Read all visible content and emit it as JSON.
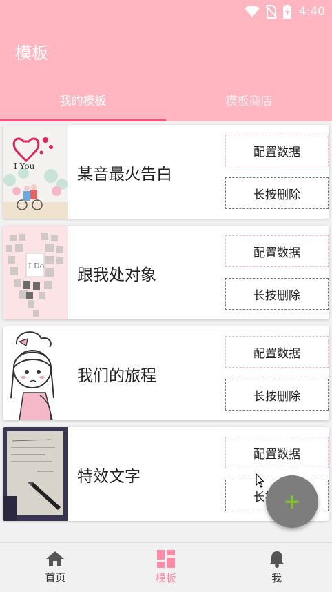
{
  "status": {
    "time": "4:40"
  },
  "app": {
    "title": "模板"
  },
  "tabs": [
    {
      "label": "我的模板",
      "active": true
    },
    {
      "label": "模板商店",
      "active": false
    }
  ],
  "templates": [
    {
      "title": "某音最火告白",
      "config_label": "配置数据",
      "delete_label": "长按删除",
      "thumb_text": "I  You"
    },
    {
      "title": "跟我处对象",
      "config_label": "配置数据",
      "delete_label": "长按删除",
      "thumb_text": "I Do"
    },
    {
      "title": "我们的旅程",
      "config_label": "配置数据",
      "delete_label": "长按删除"
    },
    {
      "title": "特效文字",
      "config_label": "配置数据",
      "delete_label": "长按删除"
    }
  ],
  "fab": {
    "label": "+"
  },
  "bottom_nav": [
    {
      "label": "首页",
      "icon": "home-icon",
      "active": false
    },
    {
      "label": "模板",
      "icon": "template-grid-icon",
      "active": true
    },
    {
      "label": "我",
      "icon": "bell-icon",
      "active": false
    }
  ],
  "colors": {
    "primary": "#ffb6c1",
    "accent": "#ff4f7b",
    "nav_active": "#ff8ba7",
    "fab": "#7d7d7d",
    "fab_plus": "#7cc22f"
  }
}
